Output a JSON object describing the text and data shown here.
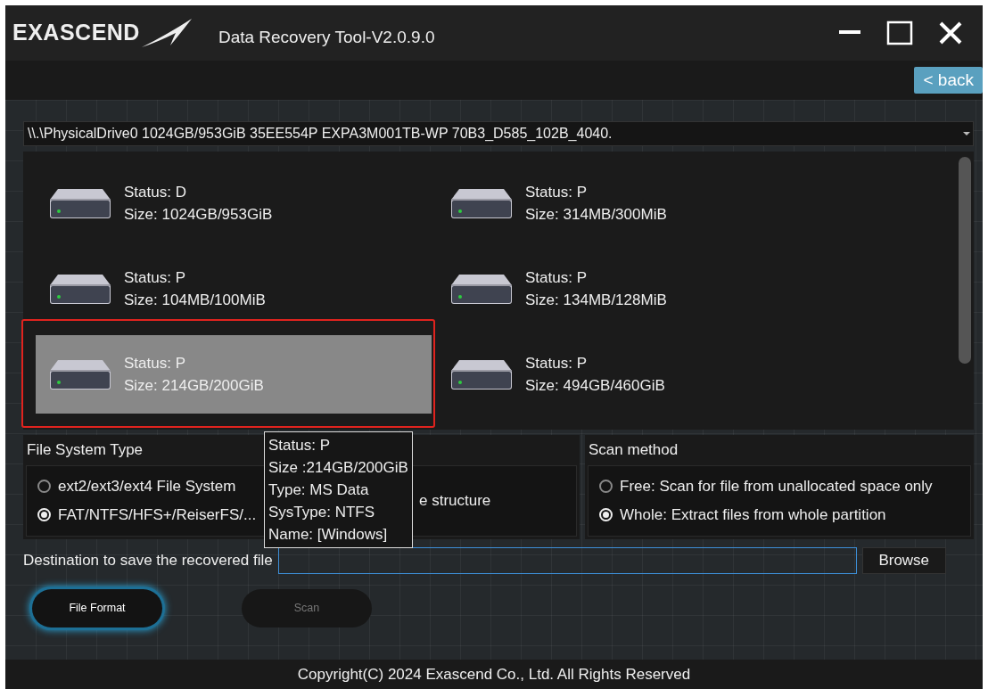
{
  "window": {
    "logo": "EXASCEND",
    "title": "Data Recovery Tool-V2.0.9.0"
  },
  "toolbar": {
    "back_button": "< back"
  },
  "drive_select": {
    "value": "\\\\.\\PhysicalDrive0 1024GB/953GiB 35EE554P EXPA3M001TB-WP 70B3_D585_102B_4040."
  },
  "partitions": [
    {
      "status": "Status: D",
      "size": "Size: 1024GB/953GiB",
      "selected": false
    },
    {
      "status": "Status: P",
      "size": "Size: 314MB/300MiB",
      "selected": false
    },
    {
      "status": "Status: P",
      "size": "Size: 104MB/100MiB",
      "selected": false
    },
    {
      "status": "Status: P",
      "size": "Size: 134MB/128MiB",
      "selected": false
    },
    {
      "status": "Status: P",
      "size": "Size: 214GB/200GiB",
      "selected": true
    },
    {
      "status": "Status: P",
      "size": "Size: 494GB/460GiB",
      "selected": false
    }
  ],
  "tooltip": {
    "lines": [
      "Status: P",
      "Size :214GB/200GiB",
      "Type: MS Data",
      "SysType: NTFS",
      "Name:  [Windows]"
    ]
  },
  "file_system": {
    "title": "File System Type",
    "options": [
      {
        "label": "ext2/ext3/ext4 File System",
        "selected": false
      },
      {
        "label": "FAT/NTFS/HFS+/ReiserFS/...",
        "selected": true
      }
    ],
    "partial_label": "e structure"
  },
  "scan_method": {
    "title": "Scan method",
    "options": [
      {
        "label": "Free: Scan for file from unallocated space only",
        "selected": false
      },
      {
        "label": "Whole: Extract files from whole partition",
        "selected": true
      }
    ]
  },
  "destination": {
    "label": "Destination to save the recovered file",
    "browse_button": "Browse"
  },
  "actions": [
    {
      "label": "File Format",
      "disabled": false,
      "focused": true
    },
    {
      "label": "Scan",
      "disabled": true,
      "focused": false
    }
  ],
  "footer": "Copyright(C) 2024 Exascend Co., Ltd. All Rights Reserved"
}
